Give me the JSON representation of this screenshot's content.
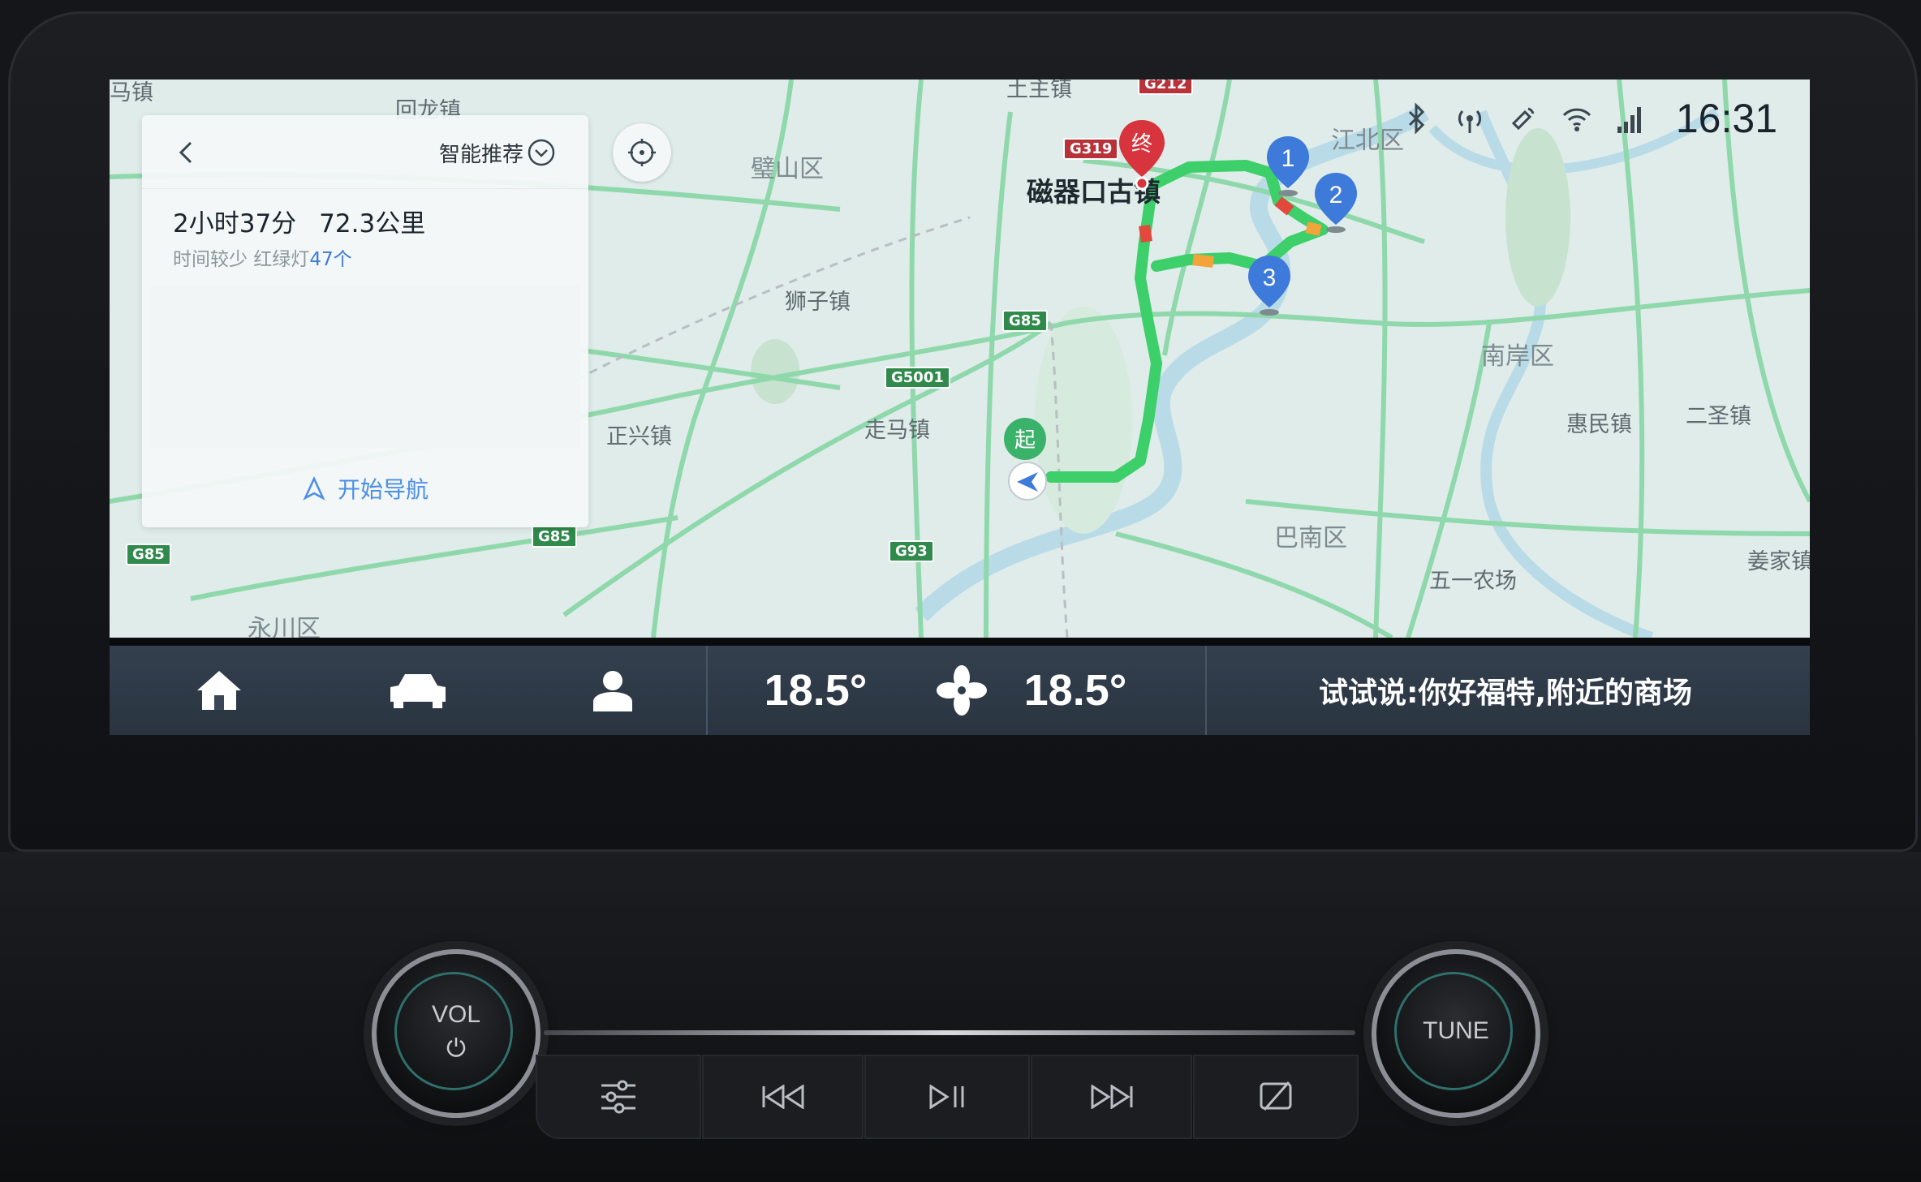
{
  "status": {
    "clock": "16:31",
    "icons": [
      "bluetooth-icon",
      "hotspot-icon",
      "satellite-icon",
      "wifi-icon",
      "signal-icon"
    ]
  },
  "route_panel": {
    "preference": "智能推荐",
    "duration": "2小时37分",
    "distance": "72.3公里",
    "detail_prefix": "时间较少 红绿灯",
    "traffic_lights": "47个",
    "start_nav": "开始导航"
  },
  "map": {
    "labels": {
      "l1": "马镇",
      "l2": "回龙镇",
      "l3": "璧山区",
      "l4": "磁器口古镇",
      "l5": "狮子镇",
      "l6": "正兴镇",
      "l7": "走马镇",
      "l8": "江北区",
      "l9": "南岸区",
      "l10": "惠民镇",
      "l11": "二圣镇",
      "l12": "巴南区",
      "l13": "五一农场",
      "l14": "姜家镇",
      "l15": "永川区",
      "l16": "土主镇"
    },
    "shields": {
      "s1": "G319",
      "s2": "G212",
      "s3": "G85",
      "s4": "G5001",
      "s5": "G85",
      "s6": "G85",
      "s7": "G93"
    },
    "markers": {
      "start": "起",
      "end": "终",
      "w1": "1",
      "w2": "2",
      "w3": "3"
    },
    "colors": {
      "route": "#3ccf6a",
      "congestion": "#f2a33a",
      "jam": "#e2483c",
      "waypoint": "#3d7ad9"
    }
  },
  "bottom_bar": {
    "temp_left": "18.5°",
    "temp_right": "18.5°",
    "voice_hint": "试试说:你好福特,附近的商场"
  },
  "console": {
    "vol_label": "VOL",
    "tune_label": "TUNE"
  }
}
